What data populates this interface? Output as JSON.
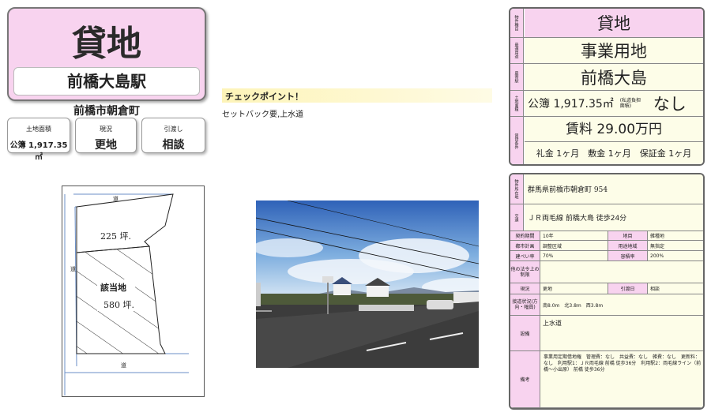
{
  "title_card": {
    "title": "貸地",
    "station": "前橋大島駅"
  },
  "town": "前橋市朝倉町",
  "mini_cards": [
    {
      "label": "土地面積",
      "value": "公簿 1,917.35㎡"
    },
    {
      "label": "現況",
      "value": "更地"
    },
    {
      "label": "引渡し",
      "value": "相談"
    }
  ],
  "checkpoint": {
    "title": "チェックポイント！",
    "text": "セットバック要,上水道"
  },
  "map": {
    "road_top": "道",
    "road_left": "道",
    "road_bottom": "道",
    "area_upper": "225 坪.",
    "target_label": "該当地",
    "area_lower": "580 坪."
  },
  "panel_top": {
    "headers": [
      "物件種目",
      "最適用途",
      "最寄駅",
      "土地面積",
      "賃貸条件"
    ],
    "type": "貸地",
    "use": "事業用地",
    "station": "前橋大島",
    "area": "公簿 1,917.35㎡",
    "area_note": "(私道負担面積)",
    "private_road": "なし",
    "rent": "賃料 29.00万円",
    "deposits": "礼金 1ヶ月　敷金 1ヶ月　保証金 1ヶ月"
  },
  "panel_bottom": {
    "loc_header": "物件所在地",
    "address": "群馬県前橋市朝倉町 954",
    "traffic_header": "交通",
    "traffic": "ＪＲ両毛線 前橋大島 徒歩24分",
    "grid": {
      "contract_period_label": "契約期間",
      "contract_period": "10年",
      "land_cat_label": "地目",
      "land_cat": "雑種地",
      "city_plan_label": "都市計画",
      "city_plan": "調整区域",
      "zoning_label": "用途地域",
      "zoning": "無指定",
      "bcr_label": "建ぺい率",
      "bcr": "70%",
      "far_label": "容積率",
      "far": "200%",
      "other_label": "他の法令上の制限",
      "status_label": "現況",
      "status": "更地",
      "delivery_label": "引渡日",
      "delivery": "相談",
      "road_label": "接道状況(方向・幅員)",
      "road": "南8.0m　北3.8m　西3.8m",
      "facility_label": "設備",
      "facility": "上水道",
      "notes_label": "備考",
      "notes": "事業用定期借地権　管理費：なし　共益費：なし　雑費：なし　更新料：なし　利用駅1：ＪＲ両毛線 前橋 徒歩36分　利用駅2：両毛線ライン（前橋～小出原） 前橋 徒歩36分"
    }
  }
}
